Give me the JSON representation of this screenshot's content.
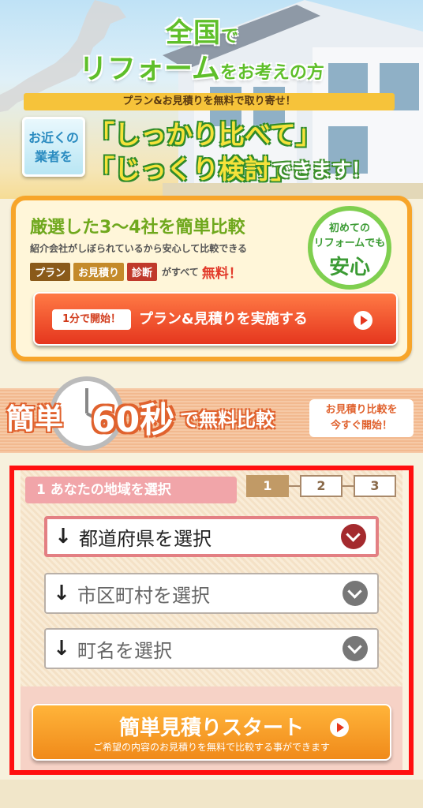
{
  "hero": {
    "title_line1_a": "全国",
    "title_line1_b": "で",
    "title_line2_a": "リフォーム",
    "title_line2_b": "をお考えの方",
    "free_bar": "プラン&お見積りを無料で取り寄せ！",
    "near_line1": "お近くの",
    "near_line2": "業者を",
    "compare_line1": "「しっかり比べて」",
    "compare_line2": "「じっくり検討」",
    "can_do": "できます！"
  },
  "card": {
    "title": "厳選した3～4社を簡単比較",
    "subtitle": "紹介会社がしぼられているから安心して比較できる",
    "tags": [
      "プラン",
      "お見積り",
      "診断"
    ],
    "tags_tail": "がすべて",
    "tags_free": "無料！",
    "anshin_line1": "初めての",
    "anshin_line2": "リフォームでも",
    "anshin_line3": "安心",
    "cta_pill": "1分で開始！",
    "cta_label": "プラン&見積りを実施する"
  },
  "banner": {
    "easy": "簡単",
    "seconds": "60秒",
    "free_compare": "で無料比較",
    "bubble_line1": "お見積り比較を",
    "bubble_line2": "今すぐ開始！"
  },
  "form": {
    "step_label": "1 あなたの地域を選択",
    "steps": [
      "1",
      "2",
      "3"
    ],
    "active_step": 1,
    "select_prefecture": "都道府県を選択",
    "select_city": "市区町村を選択",
    "select_town": "町名を選択",
    "arrow": "↓",
    "cta_label": "簡単見積りスタート",
    "cta_sub": "ご希望の内容のお見積りを無料で比較する事ができます"
  },
  "colors": {
    "green": "#5fbf2a",
    "orange": "#f7a52a",
    "red_cta": "#e5361e",
    "form_border": "#ff1010"
  }
}
